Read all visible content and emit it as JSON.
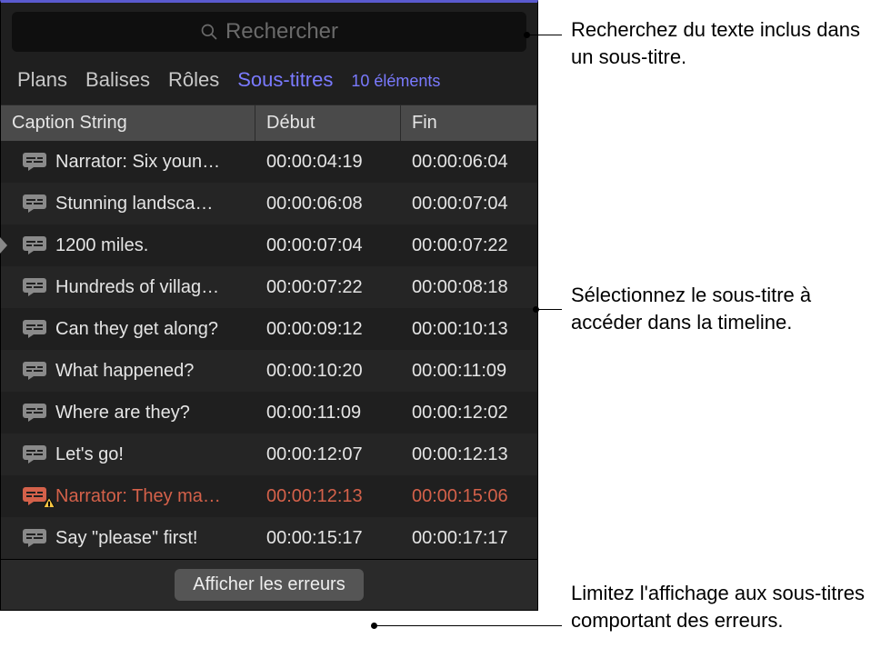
{
  "search": {
    "placeholder": "Rechercher"
  },
  "tabs": {
    "items": [
      {
        "label": "Plans"
      },
      {
        "label": "Balises"
      },
      {
        "label": "Rôles"
      },
      {
        "label": "Sous-titres"
      }
    ],
    "count_text": "10 éléments"
  },
  "table": {
    "headers": {
      "caption": "Caption String",
      "start": "Début",
      "end": "Fin"
    },
    "rows": [
      {
        "caption": "Narrator: Six youn…",
        "start": "00:00:04:19",
        "end": "00:00:06:04",
        "error": false
      },
      {
        "caption": "Stunning landsca…",
        "start": "00:00:06:08",
        "end": "00:00:07:04",
        "error": false
      },
      {
        "caption": "1200 miles.",
        "start": "00:00:07:04",
        "end": "00:00:07:22",
        "error": false
      },
      {
        "caption": "Hundreds of villag…",
        "start": "00:00:07:22",
        "end": "00:00:08:18",
        "error": false
      },
      {
        "caption": "Can they get along?",
        "start": "00:00:09:12",
        "end": "00:00:10:13",
        "error": false
      },
      {
        "caption": "What happened?",
        "start": "00:00:10:20",
        "end": "00:00:11:09",
        "error": false
      },
      {
        "caption": "Where are they?",
        "start": "00:00:11:09",
        "end": "00:00:12:02",
        "error": false
      },
      {
        "caption": "Let's go!",
        "start": "00:00:12:07",
        "end": "00:00:12:13",
        "error": false
      },
      {
        "caption": "Narrator: They ma…",
        "start": "00:00:12:13",
        "end": "00:00:15:06",
        "error": true
      },
      {
        "caption": "Say \"please\" first!",
        "start": "00:00:15:17",
        "end": "00:00:17:17",
        "error": false
      }
    ]
  },
  "footer": {
    "errors_button": "Afficher les erreurs"
  },
  "annotations": {
    "search": "Recherchez du texte inclus dans un sous-titre.",
    "select": "Sélectionnez le sous-titre à accéder dans la timeline.",
    "errors": "Limitez l'affichage aux sous-titres comportant des erreurs."
  }
}
